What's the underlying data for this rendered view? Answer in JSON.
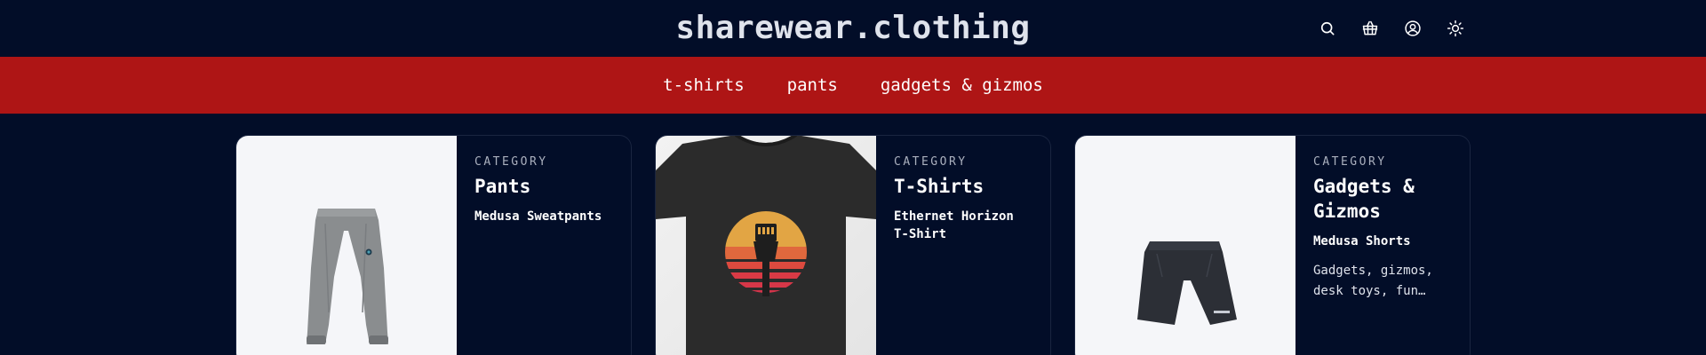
{
  "header": {
    "brand": "sharewear.clothing",
    "icons": [
      "search-icon",
      "basket-icon",
      "account-icon",
      "theme-toggle-icon"
    ]
  },
  "nav": {
    "items": [
      {
        "label": "t-shirts"
      },
      {
        "label": "pants"
      },
      {
        "label": "gadgets & gizmos"
      }
    ]
  },
  "cards": [
    {
      "category_label": "CATEGORY",
      "category_name": "Pants",
      "product_name": "Medusa Sweatpants",
      "description": ""
    },
    {
      "category_label": "CATEGORY",
      "category_name": "T-Shirts",
      "product_name": "Ethernet Horizon T-Shirt",
      "description": ""
    },
    {
      "category_label": "CATEGORY",
      "category_name": "Gadgets & Gizmos",
      "product_name": "Medusa Shorts",
      "description": "Gadgets, gizmos, desk toys, fun…"
    }
  ],
  "colors": {
    "background": "#020d28",
    "nav_bar": "#ae1515",
    "image_bg": "#f5f6f9"
  }
}
